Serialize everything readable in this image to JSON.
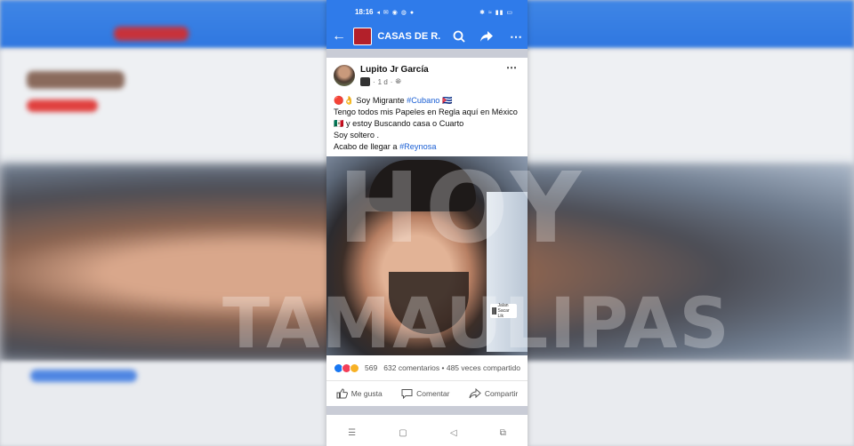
{
  "status_bar": {
    "time": "18:16"
  },
  "app_bar": {
    "group_title": "CASAS DE R..."
  },
  "post": {
    "author": "Lupito Jr García",
    "time": "1 d",
    "line1_prefix": "🔴👌 Soy Migrante ",
    "line1_tag": "#Cubano",
    "line1_suffix": " 🇨🇺",
    "line2": "Tengo todos mis Papeles en Regla aquí en México 🇲🇽 y estoy Buscando casa o Cuarto",
    "line3": "Soy soltero .",
    "line4_prefix": "Acabo de llegar a ",
    "line4_tag": "#Reynosa",
    "photo_label": "Jalan Sacar Lik"
  },
  "reactions": {
    "count": "569",
    "stats": "632 comentarios • 485 veces compartido"
  },
  "actions": {
    "like": "Me gusta",
    "comment": "Comentar",
    "share": "Compartir"
  },
  "watermark": {
    "line1": "HOY",
    "line2": "TAMAULIPAS"
  },
  "colors": {
    "brand": "#2f7bea",
    "link": "#1a5fd4"
  }
}
